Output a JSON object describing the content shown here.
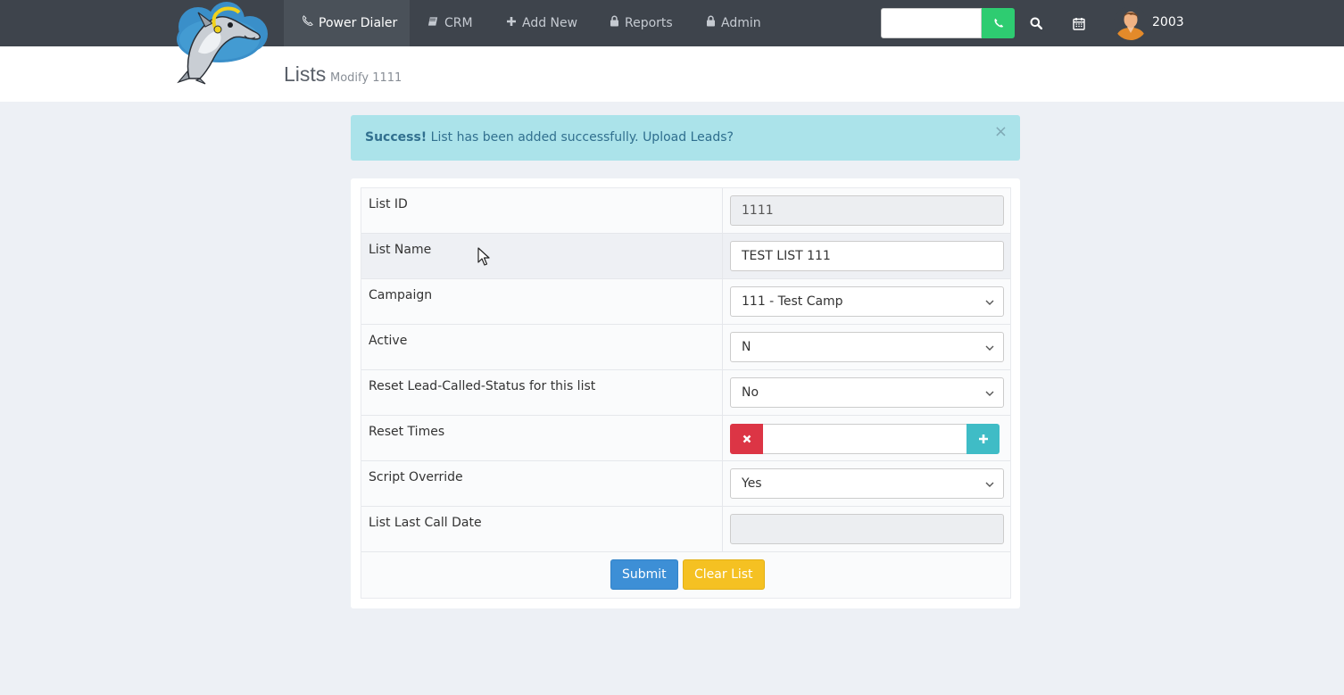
{
  "nav": {
    "items": [
      {
        "label": "Power Dialer",
        "icon": "phone-handset-icon",
        "active": true
      },
      {
        "label": "CRM",
        "icon": "book-icon",
        "active": false
      },
      {
        "label": "Add New",
        "icon": "plus-icon",
        "active": false
      },
      {
        "label": "Reports",
        "icon": "lock-icon",
        "active": false
      },
      {
        "label": "Admin",
        "icon": "lock-icon",
        "active": false
      }
    ],
    "dial_input_placeholder": "",
    "user_name": "2003"
  },
  "header": {
    "title": "Lists",
    "subtitle": "Modify 1111"
  },
  "alert": {
    "strong": "Success!",
    "message": "List has been added successfully.",
    "link": "Upload Leads?",
    "close": "×"
  },
  "form": {
    "rows": [
      {
        "label": "List ID",
        "value": "1111",
        "type": "readonly"
      },
      {
        "label": "List Name",
        "value": "TEST LIST 111",
        "type": "text"
      },
      {
        "label": "Campaign",
        "value": "111 - Test Camp",
        "type": "select"
      },
      {
        "label": "Active",
        "value": "N",
        "type": "select"
      },
      {
        "label": "Reset Lead-Called-Status for this list",
        "value": "No",
        "type": "select"
      },
      {
        "label": "Reset Times",
        "value": "",
        "type": "reset-times"
      },
      {
        "label": "Script Override",
        "value": "Yes",
        "type": "select"
      },
      {
        "label": "List Last Call Date",
        "value": "",
        "type": "readonly"
      }
    ],
    "submit_label": "Submit",
    "clear_label": "Clear List"
  },
  "colors": {
    "nav_bg": "#3e444c",
    "success_alert": "#abe3ea",
    "submit": "#3d8fd6",
    "clear": "#f5c122",
    "delete": "#dc3545",
    "add": "#3fbcc6",
    "call": "#2ecc71"
  }
}
